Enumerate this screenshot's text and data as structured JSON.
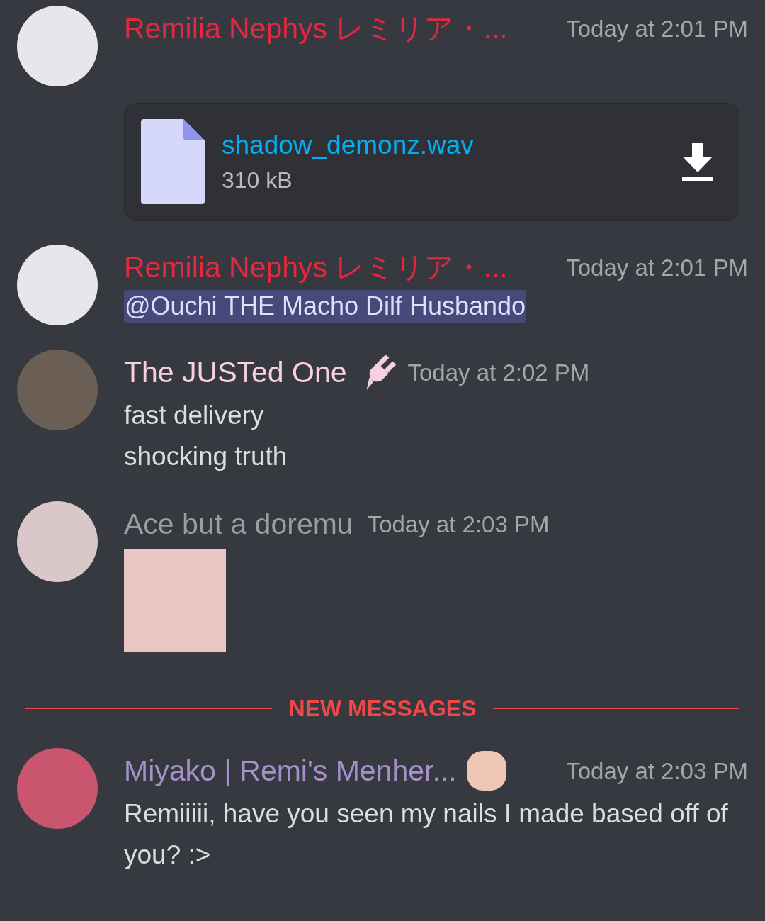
{
  "feed": [
    {
      "kind": "message",
      "author": "Remilia Nephys レミリア・...",
      "color": "#e3283f",
      "time": "Today at 2:01 PM",
      "attachment": {
        "filename": "shadow_demonz.wav",
        "size": "310 kB"
      }
    },
    {
      "kind": "message",
      "author": "Remilia Nephys レミリア・...",
      "color": "#e3283f",
      "time": "Today at 2:01 PM",
      "mention": "@Ouchi THE Macho Dilf Husbando"
    },
    {
      "kind": "message",
      "author": "The JUSTed One",
      "color": "#f8d0e2",
      "plug_icon": true,
      "time": "Today at 2:02 PM",
      "lines": [
        "fast delivery",
        "shocking truth"
      ]
    },
    {
      "kind": "message",
      "author": "Ace but a doremu",
      "color": "#9b9da3",
      "time": "Today at 2:03 PM",
      "image": true
    },
    {
      "kind": "divider",
      "label": "NEW MESSAGES"
    },
    {
      "kind": "message",
      "author": "Miyako | Remi's Menher...",
      "color": "#a68fcb",
      "sticker_icon": true,
      "time": "Today at 2:03 PM",
      "lines": [
        "Remiiiii, have you seen my nails I made based off of you? :>"
      ]
    }
  ]
}
